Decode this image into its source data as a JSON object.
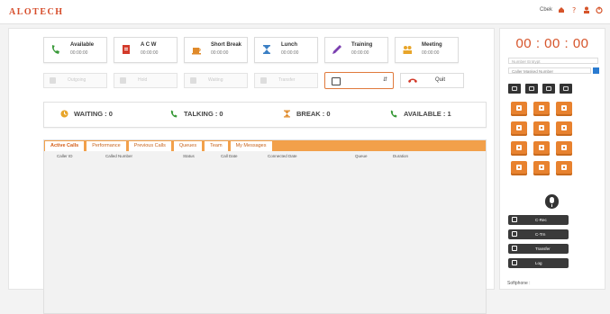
{
  "header": {
    "logo": "ALOTECH",
    "user_short": "Cbek"
  },
  "status_cards": [
    {
      "label": "Available",
      "time": "00:00:00",
      "icon": "phone-icon",
      "color": "#3a9a3a"
    },
    {
      "label": "A C W",
      "time": "00:00:00",
      "icon": "document-icon",
      "color": "#d33b2b"
    },
    {
      "label": "Short Break",
      "time": "00:00:00",
      "icon": "coffee-icon",
      "color": "#e08a2a"
    },
    {
      "label": "Lunch",
      "time": "00:00:00",
      "icon": "hourglass-icon",
      "color": "#3b7fc4"
    },
    {
      "label": "Training",
      "time": "00:00:00",
      "icon": "pencil-icon",
      "color": "#7b3fb0"
    },
    {
      "label": "Meeting",
      "time": "00:00:00",
      "icon": "people-icon",
      "color": "#e8a52a"
    }
  ],
  "actions": [
    {
      "label": "Outgoing",
      "name": "outgoing-button"
    },
    {
      "label": "Hold",
      "name": "hold-button"
    },
    {
      "label": "Waiting",
      "name": "waiting-button"
    },
    {
      "label": "Transfer",
      "name": "transfer-button"
    }
  ],
  "quit_label": "Quit",
  "counts": [
    {
      "label": "WAITING : 0",
      "icon": "clock-icon",
      "color": "#e8a52a"
    },
    {
      "label": "TALKING : 0",
      "icon": "phone-talk-icon",
      "color": "#3a9a3a"
    },
    {
      "label": "BREAK : 0",
      "icon": "hourglass-icon",
      "color": "#e08a2a"
    },
    {
      "label": "AVAILABLE : 1",
      "icon": "phone-icon",
      "color": "#3a9a3a"
    }
  ],
  "tabs": [
    "Active Calls",
    "Performance",
    "Previous Calls",
    "Queues",
    "Team",
    "My Messages"
  ],
  "columns": [
    "Caller ID",
    "Called Number",
    "Status",
    "Call Date",
    "Connected Date",
    "Queue",
    "Duration"
  ],
  "right_panel": {
    "timer": "00 : 00 : 00",
    "input_placeholder": "Number Entrypt",
    "input_value": "Caller Masked Number",
    "call_buttons": [
      "C-Rec",
      "C-Trn",
      "Transfer",
      "Log"
    ],
    "softphone_label": "Softphone :"
  }
}
